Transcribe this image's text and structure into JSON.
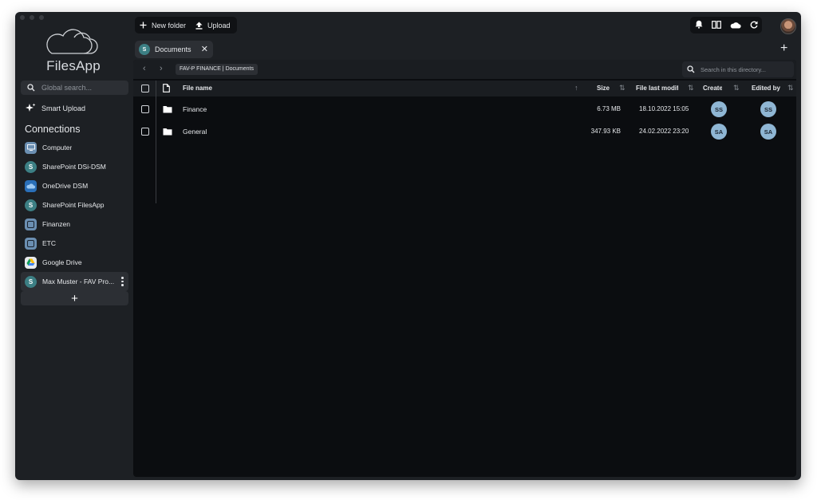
{
  "app": {
    "logo_text": "FilesApp"
  },
  "sidebar": {
    "search_placeholder": "Global search...",
    "smart_upload_label": "Smart Upload",
    "connections_heading": "Connections",
    "connections": [
      {
        "label": "Computer",
        "icon": "computer-icon",
        "color": "#6b8fb2",
        "glyph": ""
      },
      {
        "label": "SharePoint DSi-DSM",
        "icon": "sharepoint-icon",
        "color": "#3c7f84",
        "glyph": "S"
      },
      {
        "label": "OneDrive DSM",
        "icon": "onedrive-icon",
        "color": "#2a6fb8",
        "glyph": ""
      },
      {
        "label": "SharePoint FilesApp",
        "icon": "sharepoint-icon",
        "color": "#3c7f84",
        "glyph": "S"
      },
      {
        "label": "Finanzen",
        "icon": "folder-drive-icon",
        "color": "#6b8fb2",
        "glyph": ""
      },
      {
        "label": "ETC",
        "icon": "folder-drive-icon",
        "color": "#6b8fb2",
        "glyph": ""
      },
      {
        "label": "Google Drive",
        "icon": "google-drive-icon",
        "color": "#e8eaed",
        "glyph": ""
      },
      {
        "label": "Max Muster - FAV Pro...",
        "icon": "sharepoint-icon",
        "color": "#3c7f84",
        "glyph": "S"
      }
    ]
  },
  "toolbar": {
    "new_folder_label": "New folder",
    "upload_label": "Upload"
  },
  "tab": {
    "label": "Documents",
    "close": "✕"
  },
  "path": {
    "breadcrumb": "FAV-P FINANCE | Documents",
    "search_placeholder": "Search in this directory..."
  },
  "table": {
    "headers": {
      "name": "File name",
      "size": "Size",
      "modified": "File last modifi",
      "created": "Create",
      "edited": "Edited by"
    },
    "rows": [
      {
        "name": "Finance",
        "size": "6.73 MB",
        "modified": "18.10.2022 15:05",
        "created_by": "SS",
        "edited_by": "SS"
      },
      {
        "name": "General",
        "size": "347.93 KB",
        "modified": "24.02.2022 23:20",
        "created_by": "SA",
        "edited_by": "SA"
      }
    ]
  },
  "colors": {
    "accent_badge": "#8fb6d4",
    "background": "#1d2024",
    "panel": "#0b0d10"
  }
}
